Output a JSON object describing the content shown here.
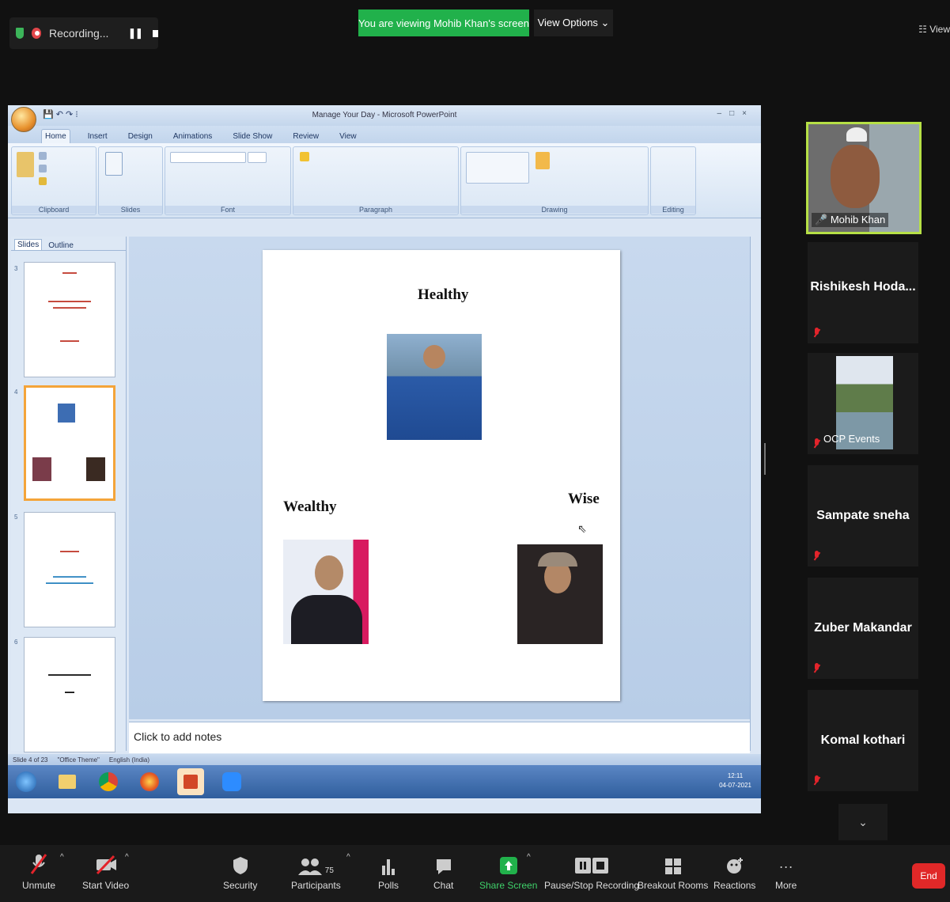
{
  "top": {
    "recording_label": "Recording...",
    "viewing_label": "You are viewing Mohib Khan's screen",
    "view_options_label": "View Options ⌄",
    "view_right_label": "☷ View"
  },
  "ppt": {
    "window_title": "Manage Your Day - Microsoft PowerPoint",
    "tabs": [
      "Home",
      "Insert",
      "Design",
      "Animations",
      "Slide Show",
      "Review",
      "View"
    ],
    "groups": [
      "Clipboard",
      "Slides",
      "Font",
      "Paragraph",
      "Drawing",
      "Editing"
    ],
    "slide_tabs": [
      "Slides",
      "Outline"
    ],
    "slide_heading_healthy": "Healthy",
    "slide_heading_wealthy": "Wealthy",
    "slide_heading_wise": "Wise",
    "notes_placeholder": "Click to add notes",
    "statusbar": [
      "Slide 4 of 23",
      "\"Office Theme\"",
      "English (India)"
    ],
    "tray_time": "12:11",
    "tray_date": "04-07-2021"
  },
  "participants": {
    "video_name": "Mohib Khan",
    "tiles": [
      "Rishikesh  Hoda...",
      "OCP Events",
      "Sampate sneha",
      "Zuber Makandar",
      "Komal kothari"
    ]
  },
  "toolbar": {
    "unmute": "Unmute",
    "start_video": "Start Video",
    "security": "Security",
    "participants": "Participants",
    "participants_count": "75",
    "polls": "Polls",
    "chat": "Chat",
    "share_screen": "Share Screen",
    "pause_stop": "Pause/Stop Recording",
    "breakout": "Breakout Rooms",
    "reactions": "Reactions",
    "more": "More",
    "end": "End"
  },
  "colors": {
    "accent_green": "#21b14b",
    "end_red": "#e02828",
    "speaker_border": "#b6e046"
  }
}
